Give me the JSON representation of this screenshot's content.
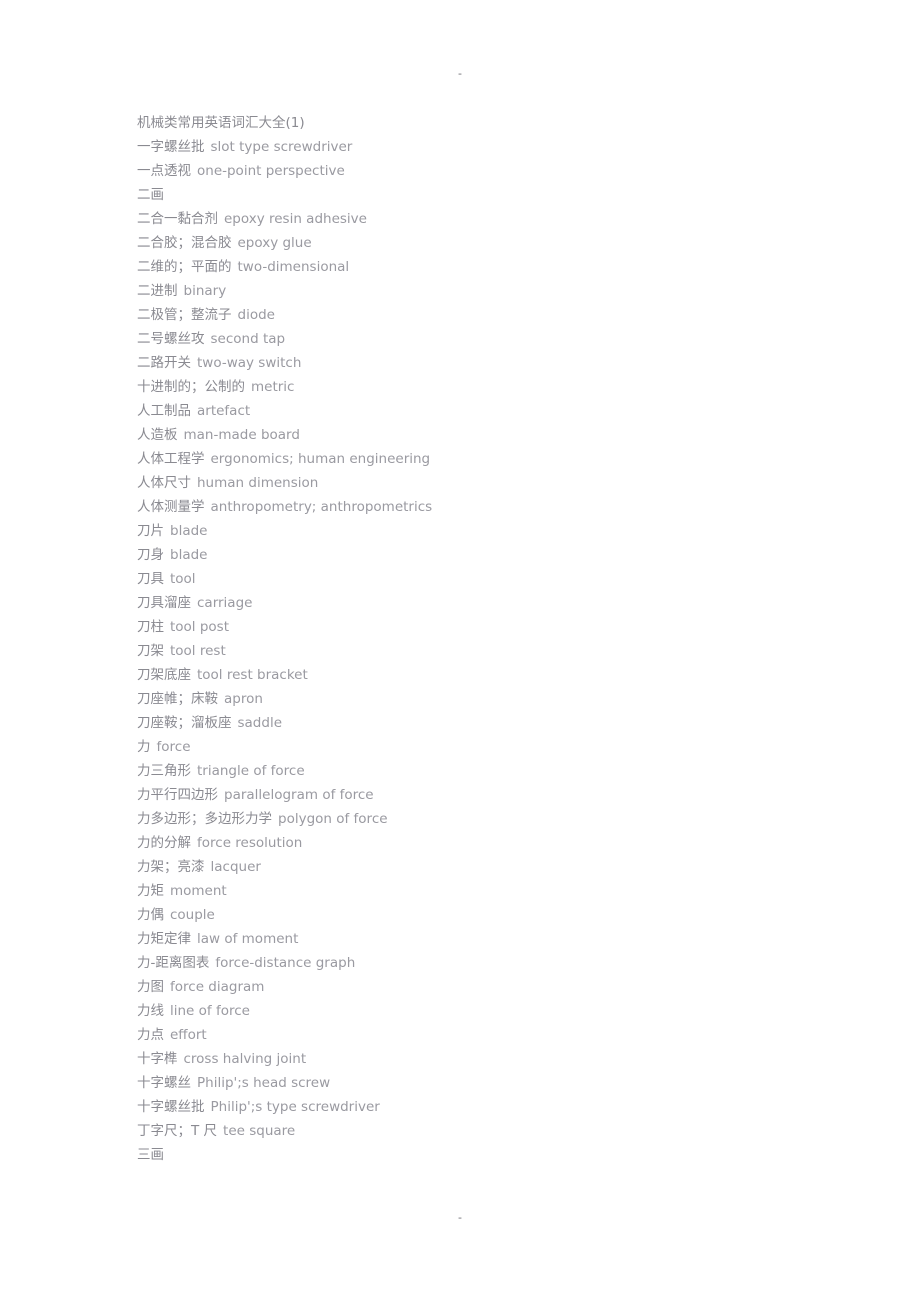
{
  "document": {
    "title": "机械类常用英语词汇大全(1)",
    "header_mark": "-",
    "footer_mark": "-"
  },
  "entries": [
    {
      "zh": "机械类常用英语词汇大全(1)",
      "en": "",
      "kind": "title"
    },
    {
      "zh": "一字螺丝批",
      "en": "slot type screwdriver",
      "kind": "term"
    },
    {
      "zh": "一点透视",
      "en": "one-point perspective",
      "kind": "term"
    },
    {
      "zh": "二画",
      "en": "",
      "kind": "section"
    },
    {
      "zh": "二合一黏合剂",
      "en": "epoxy resin adhesive",
      "kind": "term"
    },
    {
      "zh": "二合胶；混合胶",
      "en": "epoxy glue",
      "kind": "term"
    },
    {
      "zh": "二维的；平面的",
      "en": "two-dimensional",
      "kind": "term"
    },
    {
      "zh": "二进制",
      "en": "binary",
      "kind": "term"
    },
    {
      "zh": "二极管；整流子",
      "en": "diode",
      "kind": "term"
    },
    {
      "zh": "二号螺丝攻",
      "en": "second tap",
      "kind": "term"
    },
    {
      "zh": "二路开关",
      "en": "two-way switch",
      "kind": "term"
    },
    {
      "zh": "十进制的；公制的",
      "en": "metric",
      "kind": "term"
    },
    {
      "zh": "人工制品",
      "en": "artefact",
      "kind": "term"
    },
    {
      "zh": "人造板",
      "en": "man-made board",
      "kind": "term"
    },
    {
      "zh": "人体工程学",
      "en": "ergonomics; human engineering",
      "kind": "term"
    },
    {
      "zh": "人体尺寸",
      "en": "human dimension",
      "kind": "term"
    },
    {
      "zh": "人体测量学",
      "en": "anthropometry; anthropometrics",
      "kind": "term"
    },
    {
      "zh": "刀片",
      "en": "blade",
      "kind": "term"
    },
    {
      "zh": "刀身",
      "en": "blade",
      "kind": "term"
    },
    {
      "zh": "刀具",
      "en": "tool",
      "kind": "term"
    },
    {
      "zh": "刀具溜座",
      "en": "carriage",
      "kind": "term"
    },
    {
      "zh": "刀柱",
      "en": "tool post",
      "kind": "term"
    },
    {
      "zh": "刀架",
      "en": "tool rest",
      "kind": "term"
    },
    {
      "zh": "刀架底座",
      "en": "tool rest bracket",
      "kind": "term"
    },
    {
      "zh": "刀座帷；床鞍",
      "en": "apron",
      "kind": "term"
    },
    {
      "zh": "刀座鞍；溜板座",
      "en": "saddle",
      "kind": "term"
    },
    {
      "zh": "力",
      "en": "force",
      "kind": "term"
    },
    {
      "zh": "力三角形",
      "en": "triangle of force",
      "kind": "term"
    },
    {
      "zh": "力平行四边形",
      "en": "parallelogram of force",
      "kind": "term"
    },
    {
      "zh": "力多边形；多边形力学",
      "en": "polygon of force",
      "kind": "term"
    },
    {
      "zh": "力的分解",
      "en": "force resolution",
      "kind": "term"
    },
    {
      "zh": "力架；亮漆",
      "en": "lacquer",
      "kind": "term"
    },
    {
      "zh": "力矩",
      "en": "moment",
      "kind": "term"
    },
    {
      "zh": "力偶",
      "en": "couple",
      "kind": "term"
    },
    {
      "zh": "力矩定律",
      "en": "law of moment",
      "kind": "term"
    },
    {
      "zh": "力-距离图表",
      "en": "force-distance graph",
      "kind": "term"
    },
    {
      "zh": "力图",
      "en": "force diagram",
      "kind": "term"
    },
    {
      "zh": "力线",
      "en": "line of force",
      "kind": "term"
    },
    {
      "zh": "力点",
      "en": "effort",
      "kind": "term"
    },
    {
      "zh": "十字榫",
      "en": "cross halving joint",
      "kind": "term"
    },
    {
      "zh": "十字螺丝",
      "en": "Philip';s head screw",
      "kind": "term"
    },
    {
      "zh": "十字螺丝批",
      "en": "Philip';s type screwdriver",
      "kind": "term"
    },
    {
      "zh": "丁字尺；T 尺",
      "en": "tee square",
      "kind": "term"
    },
    {
      "zh": "三画",
      "en": "",
      "kind": "section"
    }
  ]
}
